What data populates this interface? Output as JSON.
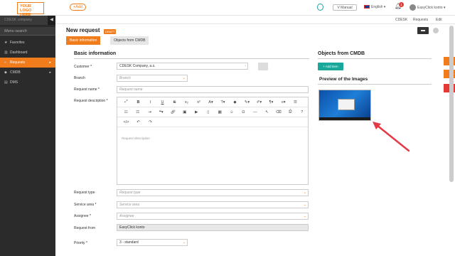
{
  "header": {
    "logo": "YOUR LOGO HERE",
    "add_label": "+Add",
    "manual_label": "V Manual",
    "language": "English",
    "notif_count": "1",
    "user": "EasyClick konto"
  },
  "sidebar": {
    "company": "CDESK company",
    "search_placeholder": "Menu search",
    "items": [
      {
        "label": "Favorites",
        "icon": "star-icon"
      },
      {
        "label": "Dashboard",
        "icon": "chart-icon"
      },
      {
        "label": "Requests",
        "icon": "ticket-icon",
        "active": true
      },
      {
        "label": "CMDB",
        "icon": "cube-icon"
      },
      {
        "label": "DMS",
        "icon": "folder-icon"
      }
    ]
  },
  "breadcrumb": [
    "CDESK",
    "Requests",
    "Edit"
  ],
  "page": {
    "title": "New request",
    "badge": "DRAFT",
    "tabs": [
      "Basic information",
      "Objects from CMDB"
    ]
  },
  "basic": {
    "heading": "Basic information",
    "customer_label": "Customer",
    "customer_value": "CDESK Company, a.s.",
    "branch_label": "Branch",
    "branch_placeholder": "Branch",
    "name_label": "Request name",
    "name_placeholder": "Request name",
    "desc_label": "Request description",
    "desc_placeholder": "Request description",
    "type_label": "Request type",
    "type_placeholder": "Request type",
    "area_label": "Service area",
    "area_placeholder": "Service area",
    "assignee_label": "Assignee",
    "assignee_placeholder": "Assignee",
    "from_label": "Request from",
    "from_value": "EasyClick konto",
    "priority_label": "Priority",
    "priority_value": "3 - standard"
  },
  "right": {
    "cmdb_heading": "Objects from CMDB",
    "add_item": "+ Add item",
    "preview_heading": "Preview of the Images"
  },
  "colors": {
    "accent": "#f07c1b",
    "teal": "#1aa89a",
    "arrow": "#e53945"
  }
}
